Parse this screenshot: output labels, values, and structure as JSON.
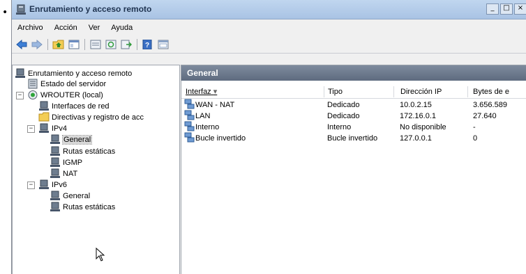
{
  "bullet": "•",
  "window": {
    "title": "Enrutamiento y acceso remoto",
    "controls": [
      "_",
      "□",
      "×"
    ]
  },
  "menu": [
    "Archivo",
    "Acción",
    "Ver",
    "Ayuda"
  ],
  "toolbar_icons": [
    "back-arrow-icon",
    "forward-arrow-icon",
    "up-folder-icon",
    "show-hide-tree-icon",
    "properties-icon",
    "refresh-icon",
    "export-icon",
    "help-icon",
    "console-view-icon"
  ],
  "tree": {
    "root": "Enrutamiento y acceso remoto",
    "status": "Estado del servidor",
    "server": "WROUTER (local)",
    "interfaces": "Interfaces de red",
    "policies": "Directivas y registro de acc",
    "ipv4": "IPv4",
    "ipv4_general": "General",
    "ipv4_static": "Rutas estáticas",
    "igmp": "IGMP",
    "nat": "NAT",
    "ipv6": "IPv6",
    "ipv6_general": "General",
    "ipv6_static": "Rutas estáticas"
  },
  "panel": {
    "title": "General",
    "columns": [
      "Interfaz",
      "Tipo",
      "Dirección IP",
      "Bytes de e"
    ],
    "sort_indicator": "▾",
    "rows": [
      {
        "name": "WAN - NAT",
        "type": "Dedicado",
        "ip": "10.0.2.15",
        "bytes": "3.656.589"
      },
      {
        "name": "LAN",
        "type": "Dedicado",
        "ip": "172.16.0.1",
        "bytes": "27.640"
      },
      {
        "name": "Interno",
        "type": "Interno",
        "ip": "No disponible",
        "bytes": "-"
      },
      {
        "name": "Bucle invertido",
        "type": "Bucle invertido",
        "ip": "127.0.0.1",
        "bytes": "0"
      }
    ]
  },
  "colors": {
    "titlebar": "#b5cce9",
    "panel_header": "#6b788b",
    "selection": "#d8d8d8"
  }
}
